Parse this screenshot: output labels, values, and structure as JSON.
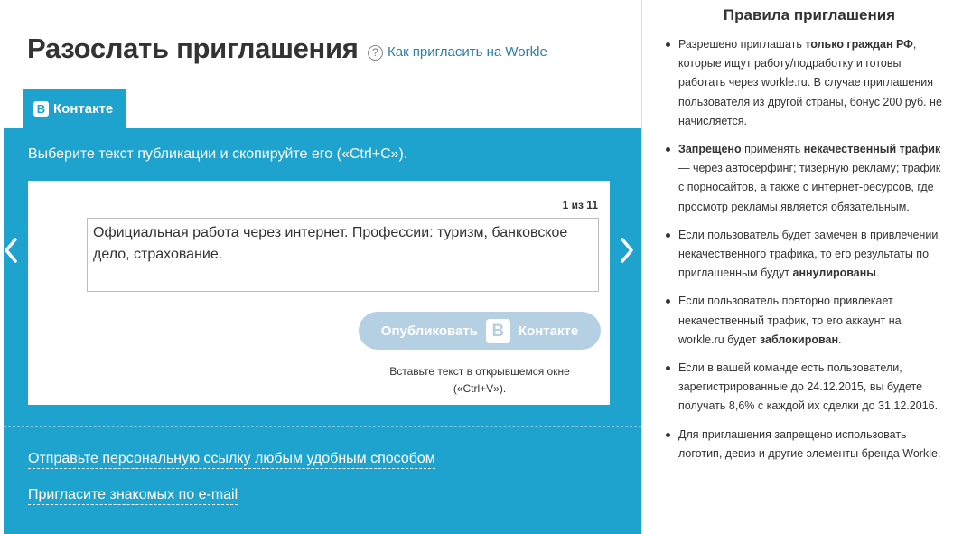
{
  "header": {
    "title": "Разослать приглашения",
    "help_icon": "?",
    "help_link": "Как пригласить на Workle"
  },
  "tabs": [
    {
      "logo": "B",
      "label": "Контакте"
    }
  ],
  "panel": {
    "instruction": "Выберите текст публикации и скопируйте его («Ctrl+C»).",
    "counter": "1 из 11",
    "publication_text": "Официальная работа через интернет. Профессии: туризм, банковское дело, страхование.",
    "publish_label": "Опубликовать",
    "publish_logo": "B",
    "publish_network": "Контакте",
    "paste_hint": "Вставьте текст в открывшемся окне («Ctrl+V»).",
    "links": {
      "personal_link": "Отправьте персональную ссылку любым удобным способом",
      "email": "Пригласите знакомых по e-mail"
    }
  },
  "icons": {
    "prev": "chevron-left-icon",
    "next": "chevron-right-icon",
    "help": "question-circle-icon"
  },
  "colors": {
    "accent": "#1ea3cf",
    "disabled_button": "#b5d0e3",
    "link": "#2c7fa8"
  },
  "sidebar": {
    "title": "Правила приглашения",
    "rules": [
      [
        {
          "t": "Разрешено приглашать "
        },
        {
          "t": "только граждан РФ",
          "b": true
        },
        {
          "t": ", которые ищут работу/подработку и готовы работать через workle.ru. В случае приглашения пользователя из другой страны, бонус 200 руб. не начисляется."
        }
      ],
      [
        {
          "t": "Запрещено",
          "b": true
        },
        {
          "t": " применять "
        },
        {
          "t": "некачественный трафик",
          "b": true
        },
        {
          "t": " — через автосёрфинг; тизерную рекламу; трафик с порносайтов, а также с интернет-ресурсов, где просмотр рекламы является обязательным."
        }
      ],
      [
        {
          "t": "Если пользователь будет замечен в привлечении некачественного трафика, то его результаты по приглашенным будут "
        },
        {
          "t": "аннулированы",
          "b": true
        },
        {
          "t": "."
        }
      ],
      [
        {
          "t": "Если пользователь повторно привлекает некачественный трафик, то его аккаунт на workle.ru будет "
        },
        {
          "t": "заблокирован",
          "b": true
        },
        {
          "t": "."
        }
      ],
      [
        {
          "t": "Если в вашей команде есть пользователи, зарегистрированные до 24.12.2015, вы будете получать 8,6% с каждой их сделки до 31.12.2016."
        }
      ],
      [
        {
          "t": "Для приглашения запрещено использовать логотип, девиз и другие элементы бренда Workle."
        }
      ]
    ]
  }
}
